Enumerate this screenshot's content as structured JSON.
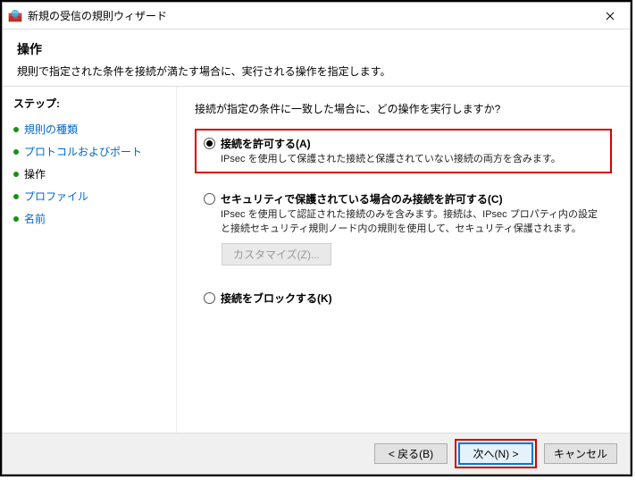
{
  "window": {
    "title": "新規の受信の規則ウィザード"
  },
  "header": {
    "title": "操作",
    "subtitle": "規則で指定された条件を接続が満たす場合に、実行される操作を指定します。"
  },
  "sidebar": {
    "heading": "ステップ:",
    "items": [
      {
        "label": "規則の種類",
        "current": false
      },
      {
        "label": "プロトコルおよびポート",
        "current": false
      },
      {
        "label": "操作",
        "current": true
      },
      {
        "label": "プロファイル",
        "current": false
      },
      {
        "label": "名前",
        "current": false
      }
    ]
  },
  "content": {
    "prompt": "接続が指定の条件に一致した場合に、どの操作を実行しますか?",
    "options": [
      {
        "id": "allow",
        "label": "接続を許可する(A)",
        "desc": "IPsec を使用して保護された接続と保護されていない接続の両方を含みます。",
        "checked": true,
        "highlighted": true
      },
      {
        "id": "allow-secure",
        "label": "セキュリティで保護されている場合のみ接続を許可する(C)",
        "desc": "IPsec を使用して認証された接続のみを含みます。接続は、IPsec プロパティ内の設定と接続セキュリティ規則ノード内の規則を使用して、セキュリティ保護されます。",
        "checked": false,
        "highlighted": false,
        "sub_button": "カスタマイズ(Z)..."
      },
      {
        "id": "block",
        "label": "接続をブロックする(K)",
        "desc": "",
        "checked": false,
        "highlighted": false
      }
    ]
  },
  "footer": {
    "back": "< 戻る(B)",
    "next": "次へ(N) >",
    "cancel": "キャンセル",
    "next_highlighted": true
  }
}
